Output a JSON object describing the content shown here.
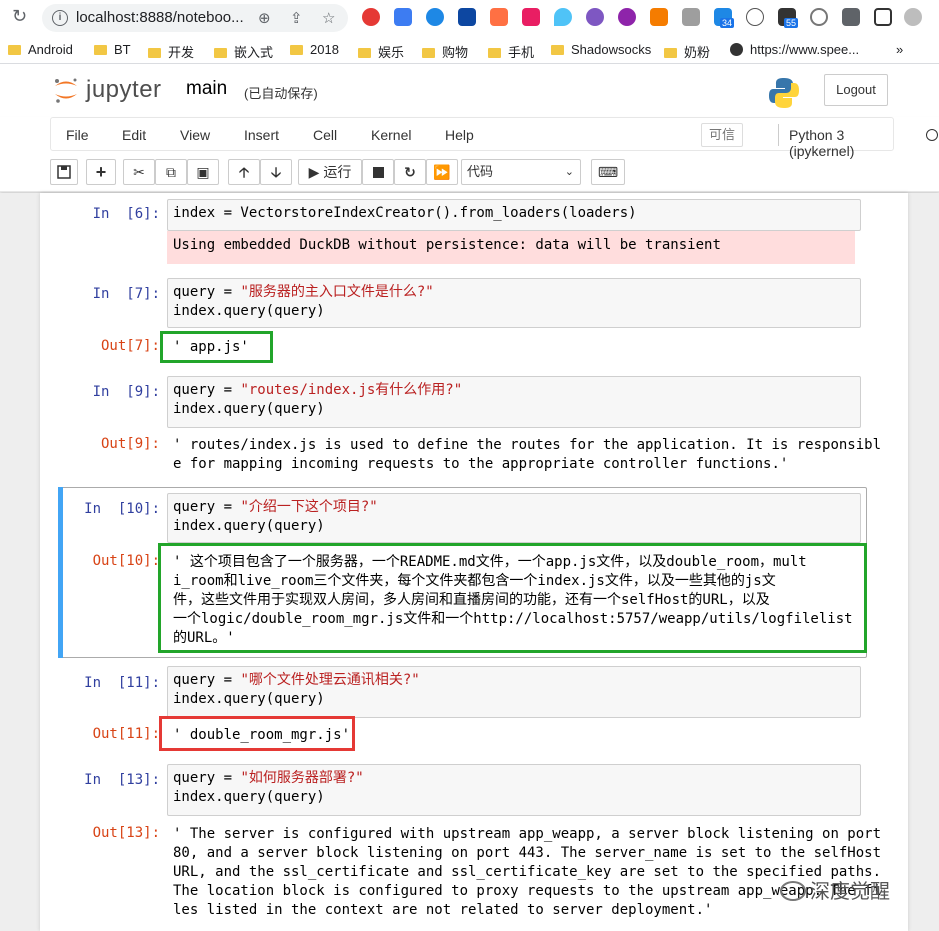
{
  "browser": {
    "url": "localhost:8888/noteboo...",
    "bookmarks": [
      "Android",
      "BT",
      "开发",
      "嵌入式",
      "2018",
      "娱乐",
      "购物",
      "手机",
      "Shadowsocks",
      "奶粉",
      "https://www.spee..."
    ],
    "badge_34": "34",
    "badge_55": "55",
    "more": "»"
  },
  "header": {
    "brand": "jupyter",
    "notebook_name": "main",
    "save_status": "(已自动保存)",
    "logout": "Logout"
  },
  "menu": {
    "items": [
      "File",
      "Edit",
      "View",
      "Insert",
      "Cell",
      "Kernel",
      "Help"
    ],
    "trusted": "可信",
    "kernel": "Python 3 (ipykernel)"
  },
  "toolbar": {
    "run_label": "运行",
    "cell_type": "代码"
  },
  "cells": {
    "c6_in_prompt": "In  [6]:",
    "c6_code": "index = VectorstoreIndexCreator().from_loaders(loaders)",
    "c6_stderr": "Using embedded DuckDB without persistence: data will be transient",
    "c7_in_prompt": "In  [7]:",
    "c7_line1_a": "query = ",
    "c7_line1_str": "\"服务器的主入口文件是什么?\"",
    "c7_line2": "index.query(query)",
    "c7_out_prompt": "Out[7]:",
    "c7_out": "' app.js'",
    "c9_in_prompt": "In  [9]:",
    "c9_line1_a": "query = ",
    "c9_line1_str": "\"routes/index.js有什么作用?\"",
    "c9_line2": "index.query(query)",
    "c9_out_prompt": "Out[9]:",
    "c9_out_1": "' routes/index.js is used to define the routes for the application. It is responsibl",
    "c9_out_2": "e for mapping incoming requests to the appropriate controller functions.'",
    "c10_in_prompt": "In  [10]:",
    "c10_line1_a": "query = ",
    "c10_line1_str": "\"介绍一下这个项目?\"",
    "c10_line2": "index.query(query)",
    "c10_out_prompt": "Out[10]:",
    "c10_out_1": "' 这个项目包含了一个服务器，一个README.md文件，一个app.js文件，以及double_room，mult",
    "c10_out_2": "i_room和live_room三个文件夹，每个文件夹都包含一个index.js文件，以及一些其他的js文",
    "c10_out_3": "件，这些文件用于实现双人房间，多人房间和直播房间的功能，还有一个selfHost的URL，以及",
    "c10_out_4": "一个logic/double_room_mgr.js文件和一个http://localhost:5757/weapp/utils/logfilelist",
    "c10_out_5": "的URL。'",
    "c11_in_prompt": "In  [11]:",
    "c11_line1_a": "query = ",
    "c11_line1_str": "\"哪个文件处理云通讯相关?\"",
    "c11_line2": "index.query(query)",
    "c11_out_prompt": "Out[11]:",
    "c11_out": "' double_room_mgr.js'",
    "c13_in_prompt": "In  [13]:",
    "c13_line1_a": "query = ",
    "c13_line1_str": "\"如何服务器部署?\"",
    "c13_line2": "index.query(query)",
    "c13_out_prompt": "Out[13]:",
    "c13_out_1": "' The server is configured with upstream app_weapp, a server block listening on port",
    "c13_out_2": "80, and a server block listening on port 443. The server_name is set to the selfHost",
    "c13_out_3": "URL, and the ssl_certificate and ssl_certificate_key are set to the specified paths.",
    "c13_out_4": "The location block is configured to proxy requests to the upstream app_weapp. The fi",
    "c13_out_5": "les listed in the context are not related to server deployment.'"
  },
  "watermark": "深度觉醒"
}
